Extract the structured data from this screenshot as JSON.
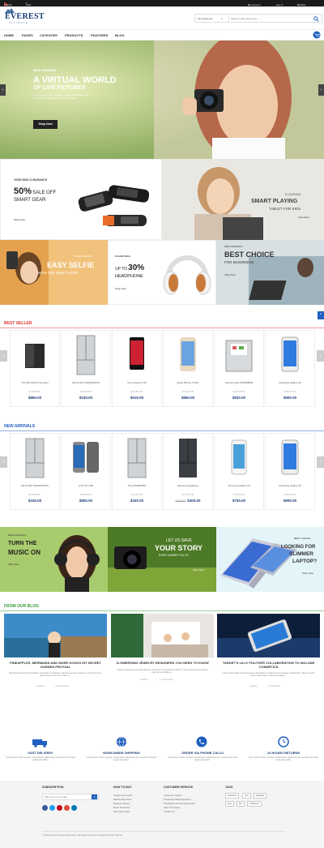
{
  "topbar": {
    "language": "English",
    "currency": "USD",
    "my_account": "My Account",
    "login": "Log In",
    "wishlist": "Wishlist"
  },
  "header": {
    "logo_title": "EVEREST",
    "logo_subtitle": "ULTIMATE",
    "search_category": "All Categories",
    "search_placeholder": "Search entire store here"
  },
  "nav": {
    "items": [
      "HOME",
      "PAGES",
      "CATEGORY",
      "PRODUCTS",
      "FEATURES",
      "BLOG"
    ]
  },
  "hero": {
    "kicker": "NEW VERSION",
    "title_line1": "A VIRTUAL WORLD",
    "title_line2": "OF LIVE PICTURES",
    "body": "Lorem ipsum dolor sit amet, consectetuer adipiscing elit, Aenean commodo ligula eget dolor.",
    "button": "Shop Now"
  },
  "promos": {
    "gear": {
      "kicker": "YEAR END CLEARANCE",
      "pct": "50%",
      "pct_suffix": "SALE OFF",
      "title": "SMART GEAR",
      "link": "Shop Now"
    },
    "tablet": {
      "kicker": "E-LEARNING",
      "title": "SMART PLAYING",
      "subtitle": "TABLET FOR KIDS",
      "link": "View More"
    },
    "selfie": {
      "kicker": "SMART PHONE",
      "title": "EASY SELFIE",
      "subtitle": "WITH THE NEW PHONE"
    },
    "headphone": {
      "kicker": "FLASH SALE",
      "prefix": "UP TO",
      "pct": "30%",
      "title": "HEADPHONE",
      "link": "Shop Now"
    },
    "business": {
      "kicker": "NEW ARRIVALS",
      "title": "BEST CHOICE",
      "subtitle": "FOR BUSSINESS",
      "link": "Shop Now"
    }
  },
  "best_seller": {
    "title": "BEST SELLER",
    "products": [
      {
        "name": "LPO BP-WJ4/3 Compact",
        "price": "$860.00",
        "stars": "★★★★★",
        "img": "mini-fridge"
      },
      {
        "name": "GE Profile PFE28KSKSS",
        "price": "$150.00",
        "stars": "★★★★★",
        "img": "fridge-silver"
      },
      {
        "name": "Sony Xperia Z 4G",
        "price": "$510.00",
        "stars": "★★★★★",
        "img": "phone-black"
      },
      {
        "name": "Apple iPhone 6 Plus",
        "price": "$860.00",
        "stars": "★★★★★",
        "img": "phone-gold"
      },
      {
        "name": "Samsung RF-FPRM3B0R",
        "price": "$520.00",
        "stars": "★★★★★",
        "img": "fridge-open"
      },
      {
        "name": "Samsung Galaxy S5",
        "price": "$900.00",
        "stars": "★★★★★",
        "img": "phone-galaxy"
      }
    ]
  },
  "new_arrivals": {
    "title": "NEW ARRIVALS",
    "products": [
      {
        "name": "GE Profile PFE28KSKSS",
        "price": "$150.00",
        "old_price": "",
        "stars": "★★★★★",
        "img": "fridge-silver"
      },
      {
        "name": "HTC One M8",
        "price": "$850.00",
        "old_price": "",
        "stars": "★★★★★",
        "img": "phone-htc"
      },
      {
        "name": "CS-LPS34PM50",
        "price": "$330.00",
        "old_price": "",
        "stars": "★★★★★",
        "img": "fridge-silver"
      },
      {
        "name": "Samsung Appliance",
        "price": "$400.00",
        "old_price": "$799.00",
        "stars": "★★★★★",
        "img": "fridge-dark"
      },
      {
        "name": "Samsung Galaxy S4",
        "price": "$750.00",
        "old_price": "",
        "stars": "★★★★★",
        "img": "phone-white"
      },
      {
        "name": "Samsung Galaxy S5",
        "price": "$900.00",
        "old_price": "",
        "stars": "★★★★★",
        "img": "phone-galaxy"
      }
    ]
  },
  "banners": {
    "music": {
      "kicker": "NEW ARRIVALS",
      "title_line1": "TURN THE",
      "title_line2": "MUSIC ON",
      "link": "Shop Now"
    },
    "story": {
      "line1": "LET US SAVE",
      "line2": "YOUR STORY",
      "line3": "EVERY WHERE YOU GO",
      "link": "Shop Now"
    },
    "laptop": {
      "kicker": "BEST CHOICE",
      "line1": "LOOKING FOR",
      "line2": "SLIMMER",
      "line3": "LAPTOP?",
      "link": "Shop Now"
    }
  },
  "blog": {
    "title": "FROM OUR BLOG",
    "posts": [
      {
        "title": "PINEAPPLES, MERMAIDS AND MORE KOOKS HIT SECRET GARDEN FESTIVAL",
        "desc": "Boutique festival Secret Garden went down in Sydney's suburbs over the weekend, and all the free-spirited kids came out to play in...",
        "author": "Admin",
        "comments": "12 Comments"
      },
      {
        "title": "11 EMERGING JEWELRY DESIGNERS YOU NEED TO KNOW",
        "desc": "Jewelry designers are a little like the rosewood of the fashion industry. They're adored, but hard to play second fiddle to...",
        "author": "Admin",
        "comments": "0 Comments"
      },
      {
        "title": "TARGET'S LILLY PULITZER COLLABORATION TO INCLUDE COSMETICS",
        "desc": "A few weeks after announcing that Lilly Pulitzer would be its next design collaborator, Target is back with a fresh tease, which will include...",
        "author": "Admin",
        "comments": "0 Comments"
      }
    ]
  },
  "features": [
    {
      "title": "FAST DELIVERY",
      "desc": "Lorem ipsum dolor sit amet, consectetuer adipiscing elit. Aenean commodo ligula eget dolor."
    },
    {
      "title": "WORLDWIDE SHIPPING",
      "desc": "Lorem ipsum dolor sit amet, consectetuer adipiscing elit. Aenean commodo ligula eget dolor."
    },
    {
      "title": "ORDER VIA PHONE CALLS",
      "desc": "Lorem ipsum dolor sit amet, consectetuer adipiscing elit. Aenean commodo ligula eget dolor."
    },
    {
      "title": "24 HOURS RETURNS",
      "desc": "Lorem ipsum dolor sit amet, consectetuer adipiscing elit. Aenean commodo ligula eget dolor."
    }
  ],
  "footer": {
    "subscription_title": "SUBSCRIPTION",
    "email_placeholder": "Sign up for your email...",
    "how_to_buy_title": "HOW TO BUY",
    "how_to_buy": [
      "Create an Account",
      "Making Payments",
      "Delivery Options",
      "Buyer Protection",
      "New User Guide"
    ],
    "customer_service_title": "CUSTOMER SERVICE",
    "customer_service": [
      "Customer Support",
      "Frequently Asked Question",
      "Transaction Service Agreement",
      "Take Our Survey",
      "Contact Us"
    ],
    "tags_title": "TAGS",
    "tags": [
      "awesome",
      "nice",
      "beautiful",
      "love",
      "like",
      "smilleamo"
    ],
    "copyright": "© 2015 Everest Ultimate Demo Store. All Rights Reserved. Designed by SNP Themes.",
    "social": [
      "facebook",
      "twitter",
      "pinterest",
      "google-plus",
      "linkedin"
    ]
  }
}
